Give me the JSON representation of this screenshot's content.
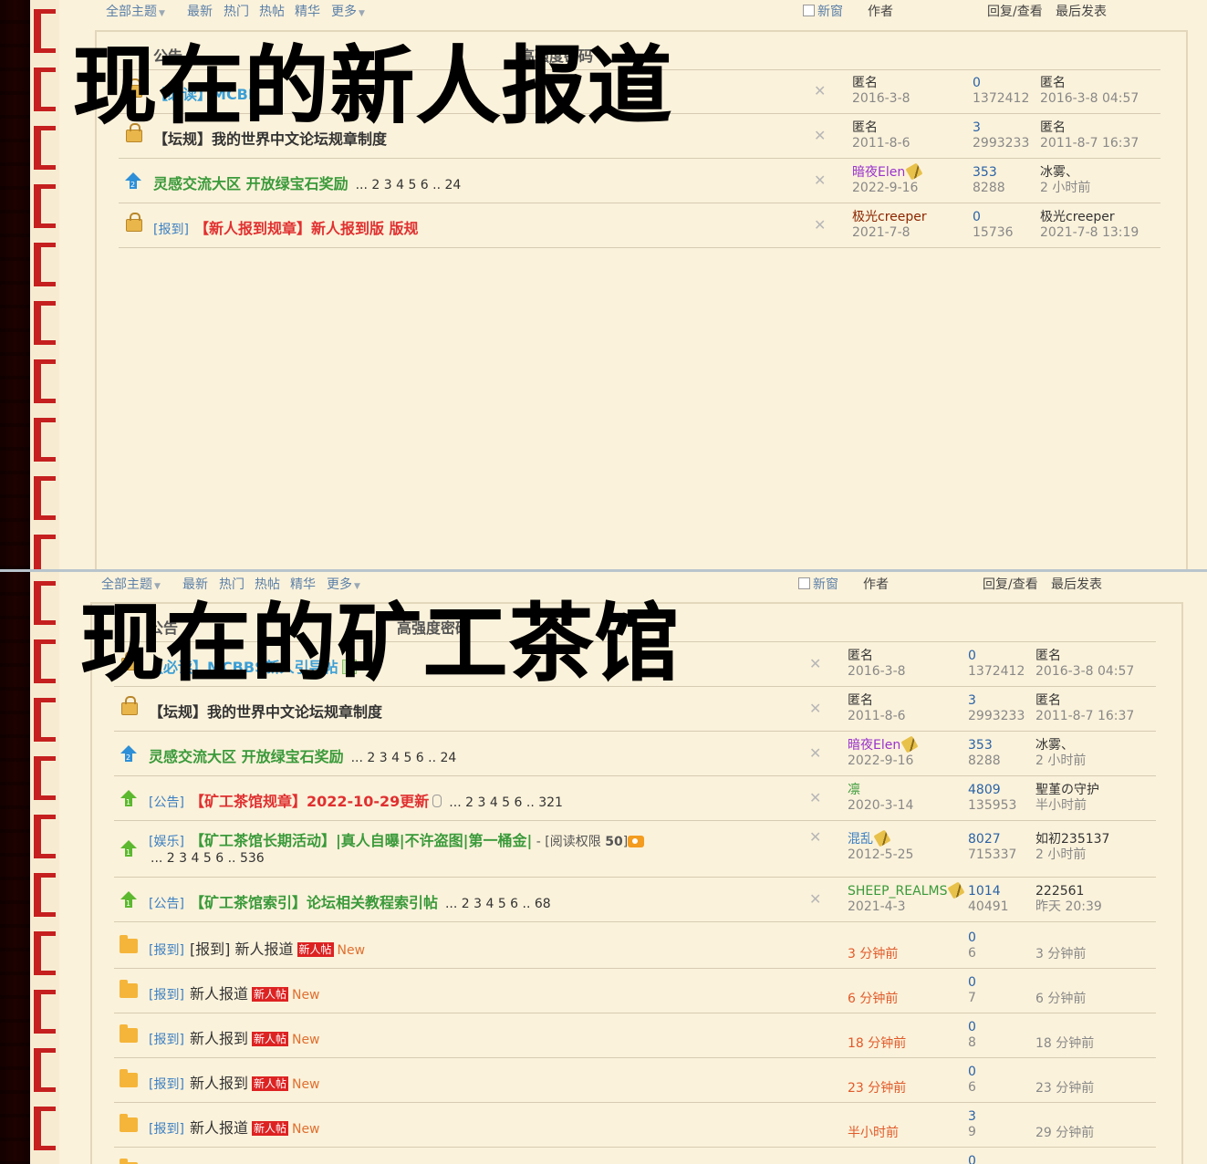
{
  "filter": {
    "all": "全部主题",
    "latest": "最新",
    "hot": "热门",
    "hotpost": "热帖",
    "digest": "精华",
    "more": "更多",
    "newwin": "新窗",
    "author": "作者",
    "reply_view": "回复/查看",
    "last_post": "最后发表"
  },
  "top": {
    "overlay": "现在的新人报道",
    "announce_partial": "公告",
    "announce_tail": "高强度密码",
    "rows": [
      {
        "title_partial": "MCBB",
        "tag": "【必读】",
        "author": "匿名",
        "date": "2016-3-8",
        "replies": "0",
        "views": "1372412",
        "last_user": "匿名",
        "last_time": "2016-3-8 04:57"
      },
      {
        "title": "【坛规】我的世界中文论坛规章制度",
        "author": "匿名",
        "date": "2011-8-6",
        "replies": "3",
        "views": "2993233",
        "last_user": "匿名",
        "last_time": "2011-8-7 16:37"
      },
      {
        "title": "灵感交流大区 开放绿宝石奖励",
        "pages": "... 2 3 4 5 6 .. 24",
        "author": "暗夜Elen",
        "date": "2022-9-16",
        "replies": "353",
        "views": "8288",
        "last_user": "冰雾、",
        "last_time": "2 小时前"
      },
      {
        "tag": "[报到]",
        "title": "【新人报到规章】新人报到版 版规",
        "author": "极光creeper",
        "date": "2021-7-8",
        "replies": "0",
        "views": "15736",
        "last_user": "极光creeper",
        "last_time": "2021-7-8 13:19"
      }
    ]
  },
  "bottom": {
    "overlay": "现在的矿工茶馆",
    "announce_partial": "公告",
    "announce_tail": "高强度密码",
    "rows": [
      {
        "tag": "【必读】",
        "title": "MCBBS新人引导帖",
        "author": "匿名",
        "date": "2016-3-8",
        "replies": "0",
        "views": "1372412",
        "last_user": "匿名",
        "last_time": "2016-3-8 04:57"
      },
      {
        "title": "【坛规】我的世界中文论坛规章制度",
        "author": "匿名",
        "date": "2011-8-6",
        "replies": "3",
        "views": "2993233",
        "last_user": "匿名",
        "last_time": "2011-8-7 16:37"
      },
      {
        "title": "灵感交流大区 开放绿宝石奖励",
        "pages": "... 2 3 4 5 6 .. 24",
        "author": "暗夜Elen",
        "date": "2022-9-16",
        "replies": "353",
        "views": "8288",
        "last_user": "冰雾、",
        "last_time": "2 小时前"
      },
      {
        "tag": "[公告]",
        "title": "【矿工茶馆规章】2022-10-29更新",
        "pages": "... 2 3 4 5 6 .. 321",
        "author": "凛",
        "date": "2020-3-14",
        "replies": "4809",
        "views": "135953",
        "last_user": "聖堇の守护",
        "last_time": "半小时前"
      },
      {
        "tag": "[娱乐]",
        "title": "【矿工茶馆长期活动】|真人自曝|不许盗图|第一桶金|",
        "extra_a": " - [阅读权限 ",
        "extra_b": "50",
        "extra_c": "]",
        "pages2": "... 2 3 4 5 6 .. 536",
        "author": "混乱",
        "date": "2012-5-25",
        "replies": "8027",
        "views": "715337",
        "last_user": "如初235137",
        "last_time": "2 小时前"
      },
      {
        "tag": "[公告]",
        "title": "【矿工茶馆索引】论坛相关教程索引帖",
        "pages": "... 2 3 4 5 6 .. 68",
        "author": "SHEEP_REALMS",
        "date": "2021-4-3",
        "replies": "1014",
        "views": "40491",
        "last_user": "222561",
        "last_time": "昨天 20:39"
      },
      {
        "tag": "[报到]",
        "title": "[报到] 新人报道",
        "badge": "新人帖",
        "new": "New",
        "age": "3 分钟前",
        "replies": "0",
        "views": "6",
        "last_time": "3 分钟前"
      },
      {
        "tag": "[报到]",
        "title": "新人报道",
        "badge": "新人帖",
        "new": "New",
        "age": "6 分钟前",
        "replies": "0",
        "views": "7",
        "last_time": "6 分钟前"
      },
      {
        "tag": "[报到]",
        "title": "新人报到",
        "badge": "新人帖",
        "new": "New",
        "age": "18 分钟前",
        "replies": "0",
        "views": "8",
        "last_time": "18 分钟前"
      },
      {
        "tag": "[报到]",
        "title": "新人报到",
        "badge": "新人帖",
        "new": "New",
        "age": "23 分钟前",
        "replies": "0",
        "views": "6",
        "last_time": "23 分钟前"
      },
      {
        "tag": "[报到]",
        "title": "新人报道",
        "badge": "新人帖",
        "new": "New",
        "age": "半小时前",
        "replies": "3",
        "views": "9",
        "last_time": "29 分钟前"
      },
      {
        "replies": "0"
      }
    ]
  }
}
